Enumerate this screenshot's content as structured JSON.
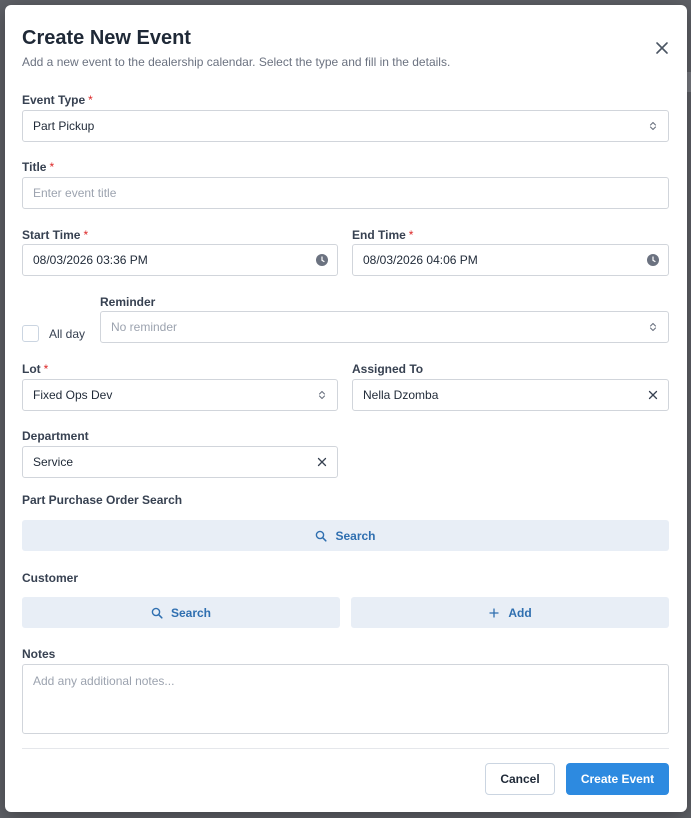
{
  "dialog": {
    "title": "Create New Event",
    "subtitle": "Add a new event to the dealership calendar. Select the type and fill in the details."
  },
  "required_marker": "*",
  "fields": {
    "event_type": {
      "label": "Event Type",
      "value": "Part Pickup"
    },
    "title": {
      "label": "Title",
      "placeholder": "Enter event title"
    },
    "start_time": {
      "label": "Start Time",
      "value": "08/03/2026 03:36 PM"
    },
    "end_time": {
      "label": "End Time",
      "value": "08/03/2026 04:06 PM"
    },
    "all_day": {
      "label": "All day",
      "checked": false
    },
    "reminder": {
      "label": "Reminder",
      "placeholder": "No reminder"
    },
    "lot": {
      "label": "Lot",
      "value": "Fixed Ops Dev"
    },
    "assigned_to": {
      "label": "Assigned To",
      "value": "Nella Dzomba"
    },
    "department": {
      "label": "Department",
      "value": "Service"
    },
    "notes": {
      "label": "Notes",
      "placeholder": "Add any additional notes..."
    }
  },
  "part_po_search": {
    "label": "Part Purchase Order Search",
    "button_label": "Search"
  },
  "customer": {
    "label": "Customer",
    "search_label": "Search",
    "add_label": "Add"
  },
  "footer": {
    "cancel_label": "Cancel",
    "submit_label": "Create Event"
  },
  "colors": {
    "primary": "#2d8ae0",
    "required": "#dc2626",
    "soft_button_bg": "#e8eef6",
    "soft_button_text": "#2f6fb0"
  }
}
